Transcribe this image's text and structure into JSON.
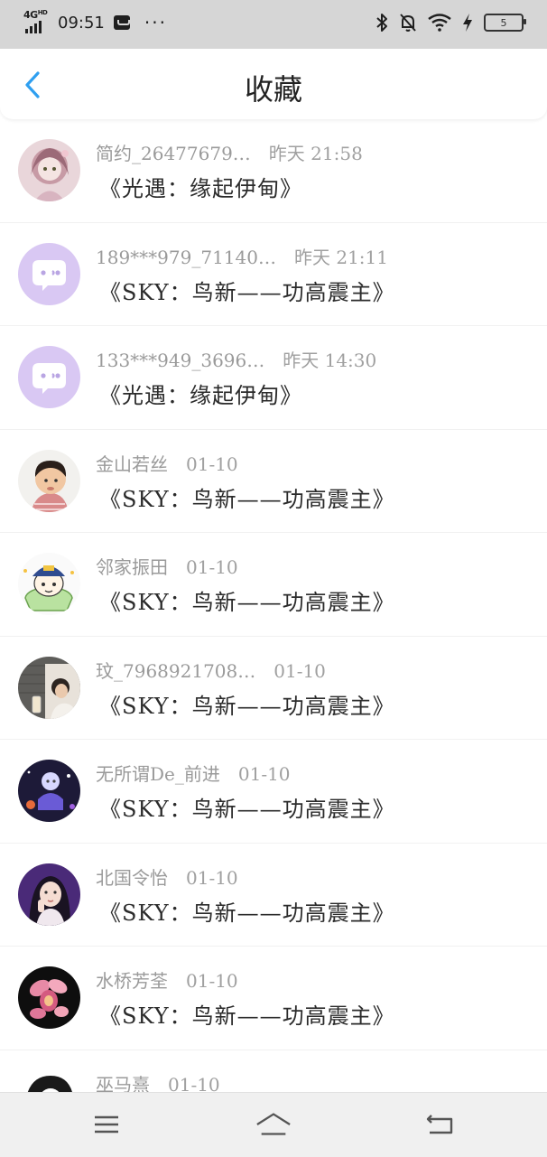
{
  "status_bar": {
    "network": "4G",
    "network_suffix": "HD",
    "time": "09:51",
    "more": "···",
    "battery": "5"
  },
  "header": {
    "title": "收藏"
  },
  "items": [
    {
      "user": "简约_26477679…",
      "time": "昨天 21:58",
      "work": "《光遇：缘起伊甸》",
      "avatar": "avatar-girl-pink"
    },
    {
      "user": "189***979_71140…",
      "time": "昨天 21:11",
      "work": "《SKY：鸟新——功高震主》",
      "avatar": "avatar-default-chat"
    },
    {
      "user": "133***949_3696…",
      "time": "昨天 14:30",
      "work": "《光遇：缘起伊甸》",
      "avatar": "avatar-default-chat"
    },
    {
      "user": "金山若丝",
      "time": "01-10",
      "work": "《SKY：鸟新——功高震主》",
      "avatar": "avatar-boy"
    },
    {
      "user": "邻家振田",
      "time": "01-10",
      "work": "《SKY：鸟新——功高震主》",
      "avatar": "avatar-cartoon"
    },
    {
      "user": "玟_7968921708…",
      "time": "01-10",
      "work": "《SKY：鸟新——功高震主》",
      "avatar": "avatar-cafe"
    },
    {
      "user": "无所谓De_前进",
      "time": "01-10",
      "work": "《SKY：鸟新——功高震主》",
      "avatar": "avatar-night-purple"
    },
    {
      "user": "北国令怡",
      "time": "01-10",
      "work": "《SKY：鸟新——功高震主》",
      "avatar": "avatar-woman-purple"
    },
    {
      "user": "水桥芳荃",
      "time": "01-10",
      "work": "《SKY：鸟新——功高震主》",
      "avatar": "avatar-orchid"
    },
    {
      "user": "巫马熹",
      "time": "01-10",
      "work": "",
      "avatar": "avatar-partial"
    }
  ],
  "colors": {
    "accent": "#2f9ff0",
    "default_avatar": "#d9c8f3"
  }
}
